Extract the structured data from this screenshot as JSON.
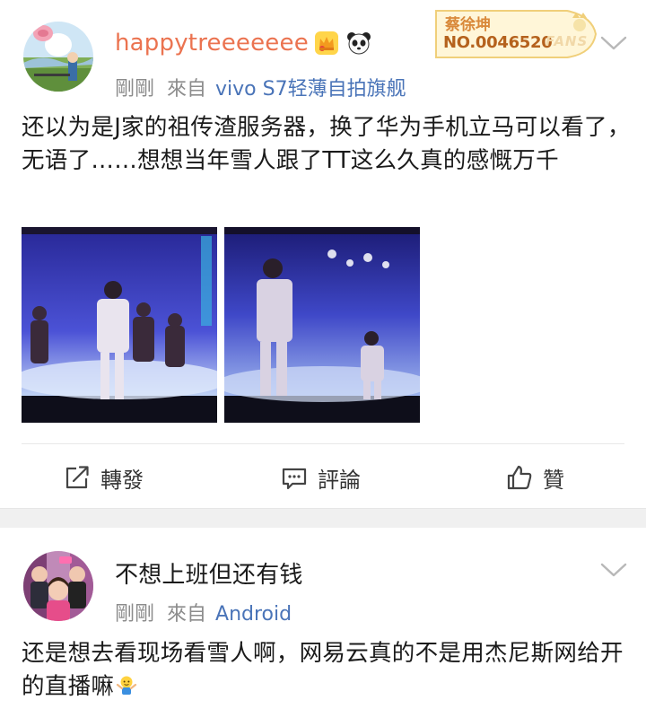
{
  "posts": [
    {
      "username": "happytreeeeeee",
      "time": "剛剛",
      "from_label": "來自",
      "source": "vivo S7轻薄自拍旗舰",
      "text": "还以为是J家的祖传渣服务器，换了华为手机立马可以看了，无语了……想想当年雪人跟了TT这么久真的感慨万千",
      "badges": [
        "crown-icon",
        "panda-icon"
      ],
      "fans_badge": {
        "name": "蔡徐坤",
        "number": "NO.0046520",
        "label": "FANS"
      },
      "images": [
        "concert-photo-1",
        "concert-photo-2"
      ],
      "actions": {
        "repost": "轉發",
        "comment": "評論",
        "like": "贊"
      }
    },
    {
      "username": "不想上班但还有钱",
      "time": "剛剛",
      "from_label": "來自",
      "source": "Android",
      "text": "还是想去看现场看雪人啊，网易云真的不是用杰尼斯网给开的直播嘛"
    }
  ],
  "colors": {
    "username_highlight": "#eb7350",
    "source_link": "#4a74b8",
    "meta_gray": "#8c8c8c",
    "separator": "#f0f0f0"
  }
}
